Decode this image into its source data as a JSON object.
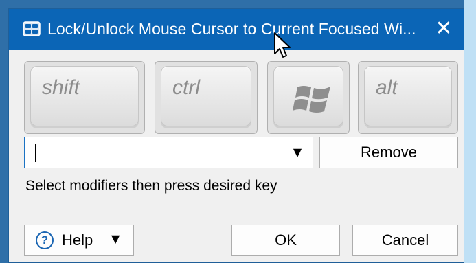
{
  "window": {
    "title": "Lock/Unlock Mouse Cursor to Current Focused Wi...",
    "close_symbol": "✕",
    "app_icon": "keyboard-app-icon"
  },
  "modifier_keys": [
    {
      "label": "shift"
    },
    {
      "label": "ctrl"
    },
    {
      "label": "",
      "icon": "windows-logo-icon"
    },
    {
      "label": "alt"
    }
  ],
  "key_input": {
    "value": "",
    "dropdown_symbol": "▼"
  },
  "buttons": {
    "remove": "Remove",
    "help": "Help",
    "help_caret": "▼",
    "ok": "OK",
    "cancel": "Cancel"
  },
  "hint_text": "Select modifiers then press desired key",
  "colors": {
    "titlebar": "#0b65b6",
    "dialog_bg": "#f0f0f0",
    "focus_border": "#1b73c4"
  }
}
